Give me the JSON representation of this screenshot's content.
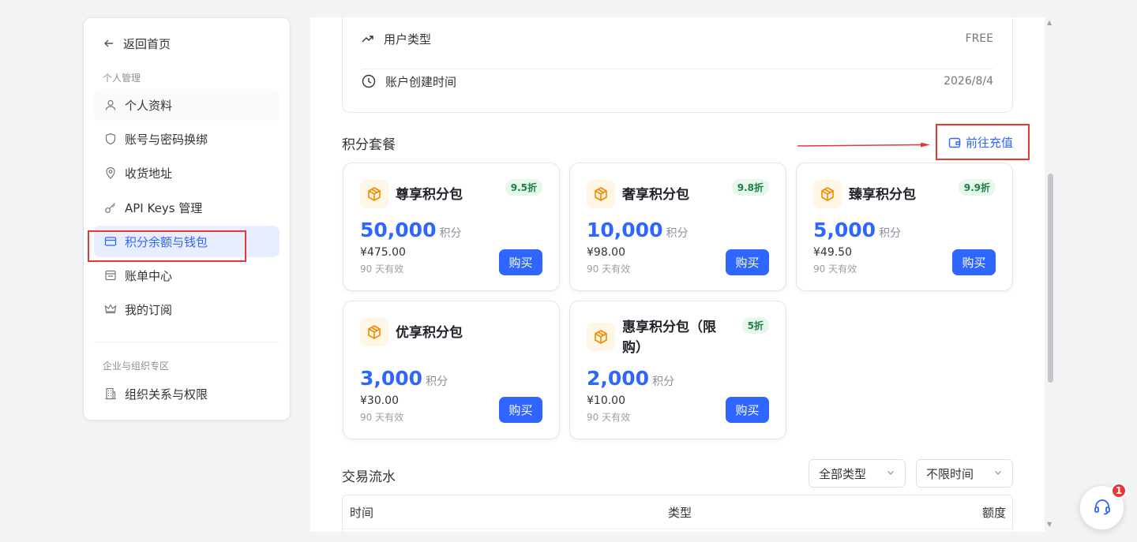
{
  "sidebar": {
    "back_label": "返回首页",
    "section_personal": "个人管理",
    "section_org": "企业与组织专区",
    "items": [
      {
        "label": "个人资料",
        "icon": "user-icon"
      },
      {
        "label": "账号与密码换绑",
        "icon": "shield-icon"
      },
      {
        "label": "收货地址",
        "icon": "location-pin-icon"
      },
      {
        "label": "API Keys 管理",
        "icon": "key-icon"
      },
      {
        "label": "积分余额与钱包",
        "icon": "credit-card-icon",
        "active": true
      },
      {
        "label": "账单中心",
        "icon": "bill-icon"
      },
      {
        "label": "我的订阅",
        "icon": "crown-icon"
      },
      {
        "label": "组织关系与权限",
        "icon": "building-icon"
      }
    ]
  },
  "account_info": {
    "user_type_label": "用户类型",
    "user_type_value": "FREE",
    "created_label": "账户创建时间",
    "created_value": "2026/8/4"
  },
  "packages_section": {
    "title": "积分套餐",
    "recharge_label": "前往充值",
    "unit_label": "积分",
    "buy_label": "购买",
    "packages": [
      {
        "name": "尊享积分包",
        "badge": "9.5折",
        "amount": "50,000",
        "price": "¥475.00",
        "validity": "90 天有效"
      },
      {
        "name": "奢享积分包",
        "badge": "9.8折",
        "amount": "10,000",
        "price": "¥98.00",
        "validity": "90 天有效"
      },
      {
        "name": "臻享积分包",
        "badge": "9.9折",
        "amount": "5,000",
        "price": "¥49.50",
        "validity": "90 天有效"
      },
      {
        "name": "优享积分包",
        "badge": "",
        "amount": "3,000",
        "price": "¥30.00",
        "validity": "90 天有效"
      },
      {
        "name": "惠享积分包（限购）",
        "badge": "5折",
        "amount": "2,000",
        "price": "¥10.00",
        "validity": "90 天有效"
      }
    ]
  },
  "transactions": {
    "title": "交易流水",
    "filter_type": "全部类型",
    "filter_time": "不限时间",
    "columns": [
      "时间",
      "类型",
      "额度"
    ]
  },
  "support": {
    "badge_count": "1"
  },
  "colors": {
    "accent": "#2e66ff",
    "badge_green": "#17833e",
    "annotation_red": "#e53935"
  }
}
